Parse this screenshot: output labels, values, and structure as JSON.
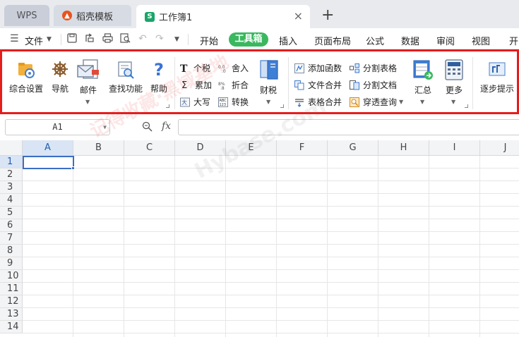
{
  "tabs": {
    "wps_label": "WPS",
    "daoke_label": "稻壳模板",
    "active_label": "工作簿1",
    "close_symbol": "×",
    "new_symbol": "+"
  },
  "menubar": {
    "file_label": "文件",
    "items": [
      "开始",
      "工具箱",
      "插入",
      "页面布局",
      "公式",
      "数据",
      "审阅",
      "视图",
      "开"
    ],
    "active_index": 1
  },
  "ribbon": {
    "general_settings": "综合设置",
    "navigation": "导航",
    "mail": "邮件",
    "find_function": "查找功能",
    "help": "帮助",
    "tax": "个税",
    "sum": "累加",
    "uppercase": "大写",
    "round": "舍入",
    "discount": "折合",
    "convert": "转换",
    "finance_tax": "财税",
    "add_function": "添加函数",
    "file_merge": "文件合并",
    "table_merge": "表格合并",
    "split_table": "分割表格",
    "split_doc": "分割文档",
    "pivot_query": "穿透查询",
    "summary": "汇总",
    "more": "更多",
    "step_hint": "逐步提示",
    "highlight_color": "#e51c1c"
  },
  "formula_bar": {
    "cell_ref": "A1",
    "fx_label": "fx",
    "formula_value": ""
  },
  "grid": {
    "columns": [
      "A",
      "B",
      "C",
      "D",
      "E",
      "F",
      "G",
      "H",
      "I",
      "J"
    ],
    "rows": [
      "1",
      "2",
      "3",
      "4",
      "5",
      "6",
      "7",
      "8",
      "9",
      "10",
      "11",
      "12",
      "13",
      "14"
    ],
    "selected_column": "A",
    "selected_row": "1"
  },
  "watermark": {
    "text_red": "记得收藏·黑域基地",
    "text_gray": "Hybase.com"
  },
  "colors": {
    "accent_green": "#3ab85f",
    "selection_blue": "#3a6fc4"
  }
}
